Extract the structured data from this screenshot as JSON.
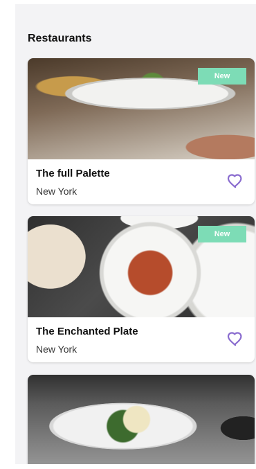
{
  "section": {
    "title": "Restaurants"
  },
  "colors": {
    "accent": "#8a6ccf",
    "badge": "#7ddcb6",
    "panel_bg": "#f3f3f5"
  },
  "restaurants": [
    {
      "name": "The full Palette",
      "location": "New York",
      "badge": "New",
      "favorite_icon": "heart-outline-icon"
    },
    {
      "name": "The Enchanted Plate",
      "location": "New York",
      "badge": "New",
      "favorite_icon": "heart-outline-icon"
    }
  ]
}
